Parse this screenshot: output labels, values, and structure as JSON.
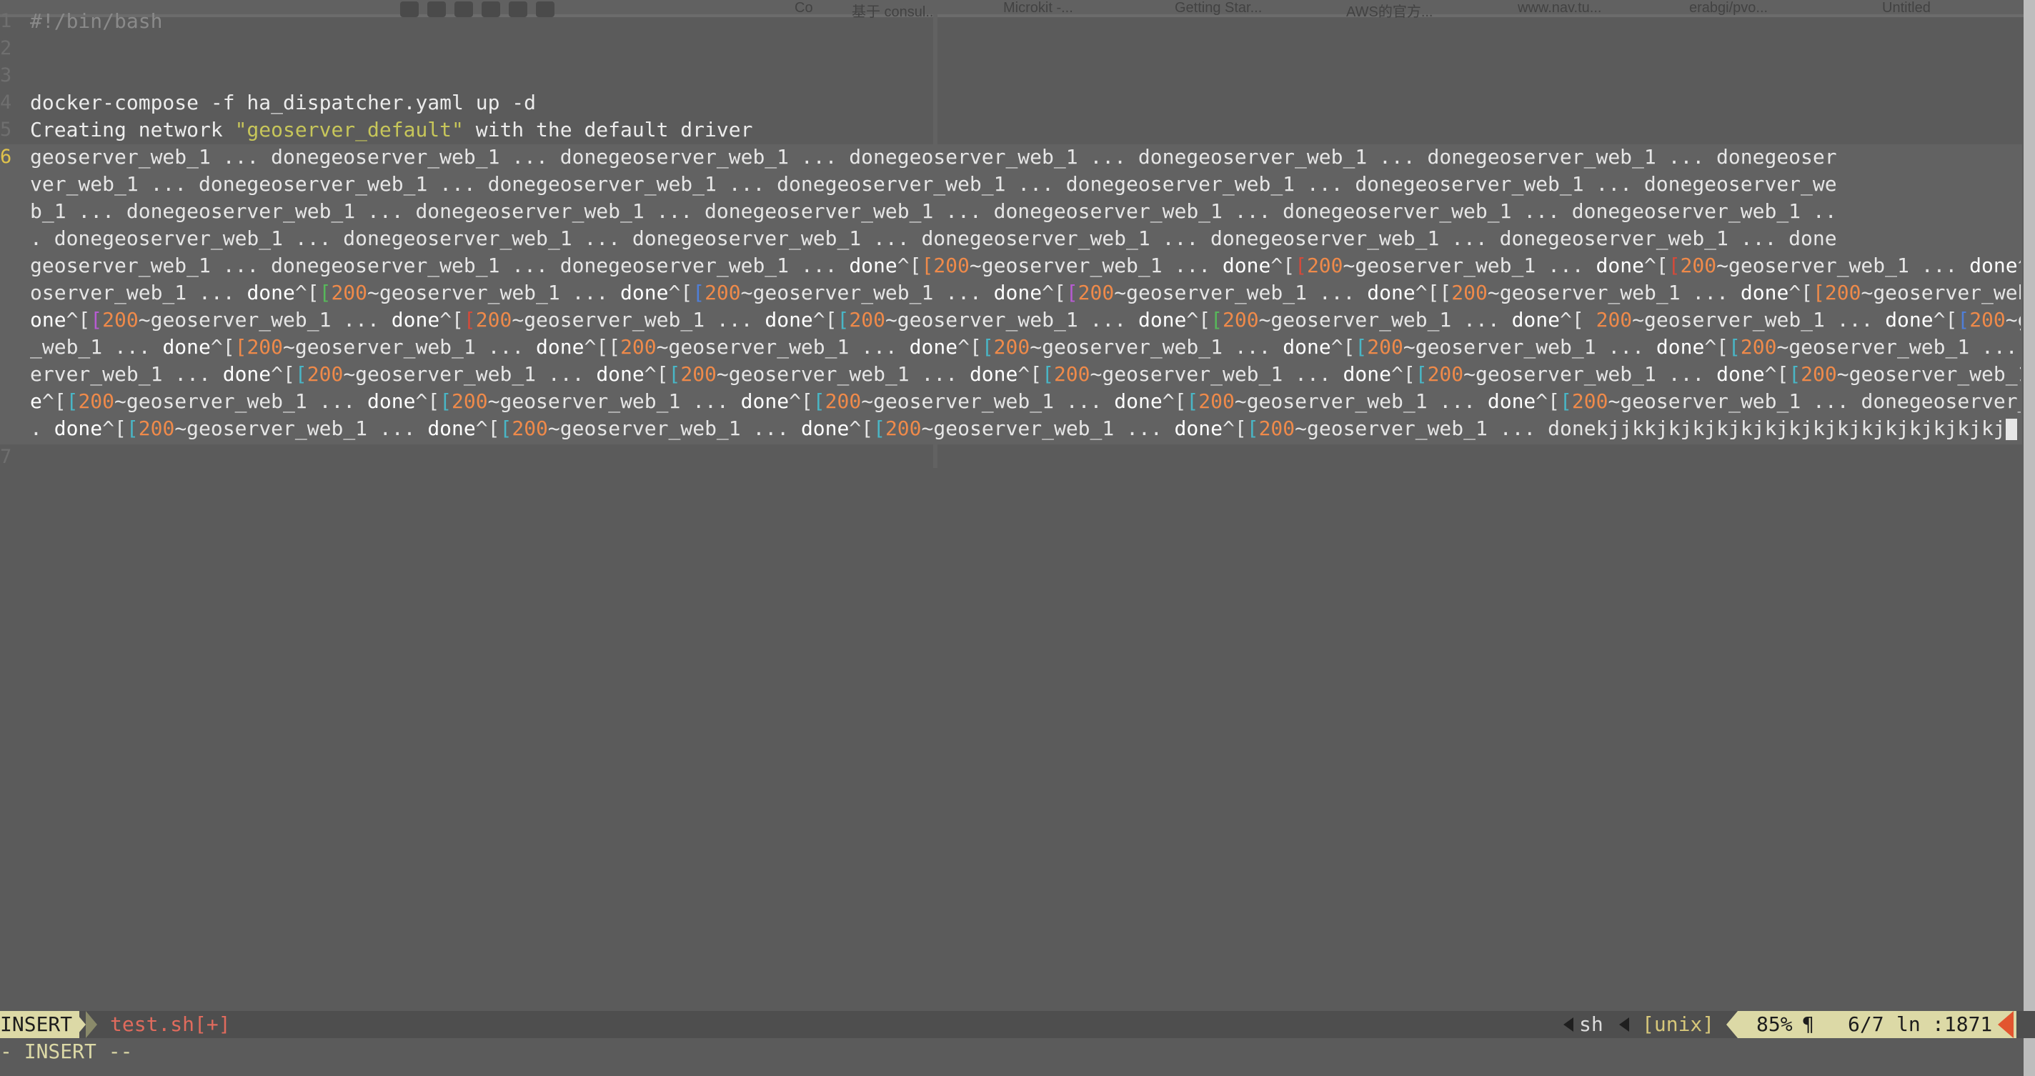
{
  "background_tabs": [
    "Co",
    "基于 consul...",
    "Microkit -...",
    "Getting Star...",
    "AWS的官方...",
    "www.nav.tu...",
    "erabgi/pvo...",
    "Untitled"
  ],
  "editor": {
    "lines": [
      {
        "number": "1",
        "text": "#!/bin/bash"
      },
      {
        "number": "2",
        "text": ""
      },
      {
        "number": "3",
        "text": ""
      },
      {
        "number": "4",
        "text": "docker-compose -f ha_dispatcher.yaml up -d"
      },
      {
        "number": "5",
        "text_before": "Creating network ",
        "text_string": "\"geoserver_default\"",
        "text_after": " with the default driver"
      },
      {
        "number": "6",
        "text": ""
      },
      {
        "number": "7",
        "text": ""
      }
    ],
    "wrapped_line": [
      [
        {
          "t": "geoserver_web_1 ... donegeoserver_web_1 ... donegeoserver_web_1 ... donegeoserver_web_1 ... donegeoserver_web_1 ... donegeoserver_web_1 ... donegeoser",
          "c": ""
        }
      ],
      [
        {
          "t": "ver_web_1 ... donegeoserver_web_1 ... donegeoserver_web_1 ... donegeoserver_web_1 ... donegeoserver_web_1 ... donegeoserver_web_1 ... donegeoserver_we",
          "c": ""
        }
      ],
      [
        {
          "t": "b_1 ... donegeoserver_web_1 ... donegeoserver_web_1 ... donegeoserver_web_1 ... donegeoserver_web_1 ... donegeoserver_web_1 ... donegeoserver_web_1 ..",
          "c": ""
        }
      ],
      [
        {
          "t": ". donegeoserver_web_1 ... donegeoserver_web_1 ... donegeoserver_web_1 ... donegeoserver_web_1 ... donegeoserver_web_1 ... donegeoserver_web_1 ... done",
          "c": ""
        }
      ],
      [
        {
          "t": "geoserver_web_1 ... donegeoserver_web_1 ... donegeoserver_web_1 ... ",
          "c": ""
        },
        {
          "t": "done",
          "c": "w"
        },
        {
          "t": "^[",
          "c": ""
        },
        {
          "t": "[",
          "c": "o"
        },
        {
          "t": "200",
          "c": "o"
        },
        {
          "t": "~geoserver_web_1 ... ",
          "c": ""
        },
        {
          "t": "done",
          "c": "w"
        },
        {
          "t": "^[",
          "c": ""
        },
        {
          "t": "[",
          "c": "r"
        },
        {
          "t": "200",
          "c": "o"
        },
        {
          "t": "~geoserver_web_1 ... ",
          "c": ""
        },
        {
          "t": "done",
          "c": "w"
        },
        {
          "t": "^[",
          "c": ""
        },
        {
          "t": "[",
          "c": "r"
        },
        {
          "t": "200",
          "c": "o"
        },
        {
          "t": "~geoserver_web_1 ... ",
          "c": ""
        },
        {
          "t": "done",
          "c": "w"
        },
        {
          "t": "^[",
          "c": ""
        },
        {
          "t": "[",
          "c": "c"
        },
        {
          "t": "200",
          "c": "o"
        },
        {
          "t": "~ge",
          "c": ""
        }
      ],
      [
        {
          "t": "oserver_web_1 ... ",
          "c": ""
        },
        {
          "t": "done",
          "c": "w"
        },
        {
          "t": "^[",
          "c": ""
        },
        {
          "t": "[",
          "c": "g"
        },
        {
          "t": "200",
          "c": "o"
        },
        {
          "t": "~geoserver_web_1 ... ",
          "c": ""
        },
        {
          "t": "done",
          "c": "w"
        },
        {
          "t": "^[",
          "c": ""
        },
        {
          "t": "[",
          "c": "b"
        },
        {
          "t": "200",
          "c": "o"
        },
        {
          "t": "~geoserver_web_1 ... ",
          "c": ""
        },
        {
          "t": "done",
          "c": "w"
        },
        {
          "t": "^[",
          "c": ""
        },
        {
          "t": "[",
          "c": "m"
        },
        {
          "t": "200",
          "c": "o"
        },
        {
          "t": "~geoserver_web_1 ... ",
          "c": ""
        },
        {
          "t": "done",
          "c": "w"
        },
        {
          "t": "^[[",
          "c": ""
        },
        {
          "t": "200",
          "c": "o"
        },
        {
          "t": "~geoserver_web_1 ... ",
          "c": ""
        },
        {
          "t": "done",
          "c": "w"
        },
        {
          "t": "^[",
          "c": ""
        },
        {
          "t": "[",
          "c": "o"
        },
        {
          "t": "200",
          "c": "o"
        },
        {
          "t": "~geoserver_web_1 ... d",
          "c": ""
        }
      ],
      [
        {
          "t": "one",
          "c": "w"
        },
        {
          "t": "^[",
          "c": ""
        },
        {
          "t": "[",
          "c": "m"
        },
        {
          "t": "200",
          "c": "o"
        },
        {
          "t": "~geoserver_web_1 ... ",
          "c": ""
        },
        {
          "t": "done",
          "c": "w"
        },
        {
          "t": "^[",
          "c": ""
        },
        {
          "t": "[",
          "c": "r"
        },
        {
          "t": "200",
          "c": "o"
        },
        {
          "t": "~geoserver_web_1 ... ",
          "c": ""
        },
        {
          "t": "done",
          "c": "w"
        },
        {
          "t": "^[",
          "c": ""
        },
        {
          "t": "[",
          "c": "c"
        },
        {
          "t": "200",
          "c": "o"
        },
        {
          "t": "~geoserver_web_1 ... ",
          "c": ""
        },
        {
          "t": "done",
          "c": "w"
        },
        {
          "t": "^[",
          "c": ""
        },
        {
          "t": "[",
          "c": "g"
        },
        {
          "t": "200",
          "c": "o"
        },
        {
          "t": "~geoserver_web_1 ... ",
          "c": ""
        },
        {
          "t": "done",
          "c": "w"
        },
        {
          "t": "^[ ",
          "c": ""
        },
        {
          "t": "200",
          "c": "o"
        },
        {
          "t": "~geoserver_web_1 ... ",
          "c": ""
        },
        {
          "t": "done",
          "c": "w"
        },
        {
          "t": "^[",
          "c": ""
        },
        {
          "t": "[",
          "c": "b"
        },
        {
          "t": "200",
          "c": "o"
        },
        {
          "t": "~geoserver",
          "c": ""
        }
      ],
      [
        {
          "t": "_web_1 ... ",
          "c": ""
        },
        {
          "t": "done",
          "c": "w"
        },
        {
          "t": "^[",
          "c": ""
        },
        {
          "t": "[",
          "c": "o"
        },
        {
          "t": "200",
          "c": "o"
        },
        {
          "t": "~geoserver_web_1 ... ",
          "c": ""
        },
        {
          "t": "done",
          "c": "w"
        },
        {
          "t": "^[[",
          "c": ""
        },
        {
          "t": "200",
          "c": "o"
        },
        {
          "t": "~geoserver_web_1 ... ",
          "c": ""
        },
        {
          "t": "done",
          "c": "w"
        },
        {
          "t": "^[",
          "c": ""
        },
        {
          "t": "[",
          "c": "c"
        },
        {
          "t": "200",
          "c": "o"
        },
        {
          "t": "~geoserver_web_1 ... ",
          "c": ""
        },
        {
          "t": "done",
          "c": "w"
        },
        {
          "t": "^[",
          "c": ""
        },
        {
          "t": "[",
          "c": "c"
        },
        {
          "t": "200",
          "c": "o"
        },
        {
          "t": "~geoserver_web_1 ... ",
          "c": ""
        },
        {
          "t": "done",
          "c": "w"
        },
        {
          "t": "^[",
          "c": ""
        },
        {
          "t": "[",
          "c": "c"
        },
        {
          "t": "200",
          "c": "o"
        },
        {
          "t": "~geoserver_web_1 ... donegeos",
          "c": ""
        }
      ],
      [
        {
          "t": "erver_web_1 ... ",
          "c": ""
        },
        {
          "t": "done",
          "c": "w"
        },
        {
          "t": "^[",
          "c": ""
        },
        {
          "t": "[",
          "c": "c"
        },
        {
          "t": "200",
          "c": "o"
        },
        {
          "t": "~geoserver_web_1 ... ",
          "c": ""
        },
        {
          "t": "done",
          "c": "w"
        },
        {
          "t": "^[",
          "c": ""
        },
        {
          "t": "[",
          "c": "c"
        },
        {
          "t": "200",
          "c": "o"
        },
        {
          "t": "~geoserver_web_1 ... ",
          "c": ""
        },
        {
          "t": "done",
          "c": "w"
        },
        {
          "t": "^[",
          "c": ""
        },
        {
          "t": "[",
          "c": "c"
        },
        {
          "t": "200",
          "c": "o"
        },
        {
          "t": "~geoserver_web_1 ... ",
          "c": ""
        },
        {
          "t": "done",
          "c": "w"
        },
        {
          "t": "^[",
          "c": ""
        },
        {
          "t": "[",
          "c": "c"
        },
        {
          "t": "200",
          "c": "o"
        },
        {
          "t": "~geoserver_web_1 ... ",
          "c": ""
        },
        {
          "t": "done",
          "c": "w"
        },
        {
          "t": "^[",
          "c": ""
        },
        {
          "t": "[",
          "c": "c"
        },
        {
          "t": "200",
          "c": "o"
        },
        {
          "t": "~geoserver_web_1 ... don",
          "c": ""
        }
      ],
      [
        {
          "t": "e",
          "c": "w"
        },
        {
          "t": "^[",
          "c": ""
        },
        {
          "t": "[",
          "c": "c"
        },
        {
          "t": "200",
          "c": "o"
        },
        {
          "t": "~geoserver_web_1 ... ",
          "c": ""
        },
        {
          "t": "done",
          "c": "w"
        },
        {
          "t": "^[",
          "c": ""
        },
        {
          "t": "[",
          "c": "c"
        },
        {
          "t": "200",
          "c": "o"
        },
        {
          "t": "~geoserver_web_1 ... ",
          "c": ""
        },
        {
          "t": "done",
          "c": "w"
        },
        {
          "t": "^[",
          "c": ""
        },
        {
          "t": "[",
          "c": "c"
        },
        {
          "t": "200",
          "c": "o"
        },
        {
          "t": "~geoserver_web_1 ... ",
          "c": ""
        },
        {
          "t": "done",
          "c": "w"
        },
        {
          "t": "^[",
          "c": ""
        },
        {
          "t": "[",
          "c": "c"
        },
        {
          "t": "200",
          "c": "o"
        },
        {
          "t": "~geoserver_web_1 ... ",
          "c": ""
        },
        {
          "t": "done",
          "c": "w"
        },
        {
          "t": "^[",
          "c": ""
        },
        {
          "t": "[",
          "c": "c"
        },
        {
          "t": "200",
          "c": "o"
        },
        {
          "t": "~geoserver_web_1 ... donegeoserver_web_1 ..",
          "c": ""
        }
      ],
      [
        {
          "t": ". ",
          "c": ""
        },
        {
          "t": "done",
          "c": "w"
        },
        {
          "t": "^[",
          "c": ""
        },
        {
          "t": "[",
          "c": "c"
        },
        {
          "t": "200",
          "c": "o"
        },
        {
          "t": "~geoserver_web_1 ... ",
          "c": ""
        },
        {
          "t": "done",
          "c": "w"
        },
        {
          "t": "^[",
          "c": ""
        },
        {
          "t": "[",
          "c": "c"
        },
        {
          "t": "200",
          "c": "o"
        },
        {
          "t": "~geoserver_web_1 ... ",
          "c": ""
        },
        {
          "t": "done",
          "c": "w"
        },
        {
          "t": "^[",
          "c": ""
        },
        {
          "t": "[",
          "c": "c"
        },
        {
          "t": "200",
          "c": "o"
        },
        {
          "t": "~geoserver_web_1 ... ",
          "c": ""
        },
        {
          "t": "done",
          "c": "w"
        },
        {
          "t": "^[",
          "c": ""
        },
        {
          "t": "[",
          "c": "c"
        },
        {
          "t": "200",
          "c": "o"
        },
        {
          "t": "~geoserver_web_1 ... ",
          "c": ""
        },
        {
          "t": "donekjjkkjkjkjkjkjkjkjkjkjkjkjkjkjkjkj",
          "c": ""
        }
      ]
    ]
  },
  "statusline": {
    "mode": "INSERT",
    "filename": "test.sh[+]",
    "filetype": "sh",
    "fileformat": "[unix]",
    "percent": "85%",
    "para_symbol": "¶",
    "position": "6/7",
    "ln_label": "ln",
    "column": ":1871"
  },
  "cmdline": {
    "text": "- INSERT --"
  },
  "colors": {
    "background": "#5b5b5b",
    "mode_badge": "#dcd9a6",
    "number_literal": "#ef8a4a",
    "string": "#c7c65a",
    "filename_modified": "#e06b5d",
    "warning": "#e2552f"
  }
}
